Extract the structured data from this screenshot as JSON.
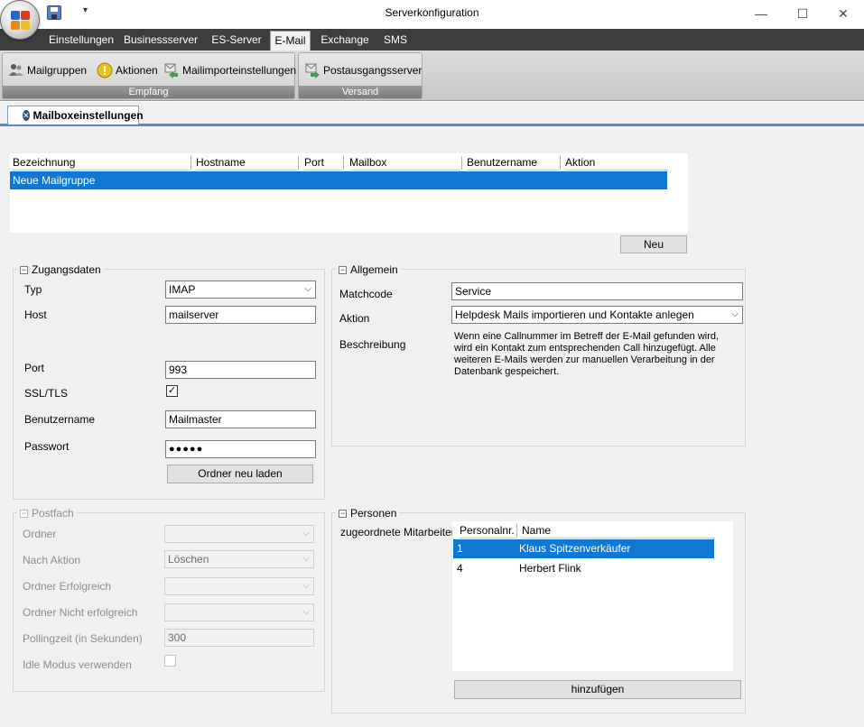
{
  "window": {
    "title": "Serverkonfiguration",
    "qat_dropdown": "▾",
    "minimize": "—",
    "maximize": "☐",
    "close": "✕"
  },
  "ribbon": {
    "tabs": [
      "Einstellungen",
      "Businessserver",
      "ES-Server",
      "E-Mail",
      "Exchange",
      "SMS"
    ],
    "active_tab": "E-Mail",
    "groups": [
      {
        "caption": "Empfang",
        "buttons": [
          {
            "label": "Mailgruppen",
            "icon": "people-icon"
          },
          {
            "label": "Aktionen",
            "icon": "warning-icon"
          },
          {
            "label": "Mailimporteinstellungen",
            "icon": "mail-import-icon"
          }
        ]
      },
      {
        "caption": "Versand",
        "buttons": [
          {
            "label": "Postausgangsserver",
            "icon": "mail-send-icon"
          }
        ]
      }
    ]
  },
  "document_tab": {
    "label": "Mailboxeinstellungen"
  },
  "mail_grid": {
    "columns": [
      "Bezeichnung",
      "Hostname",
      "Port",
      "Mailbox",
      "Benutzername",
      "Aktion"
    ],
    "rows": [
      {
        "Bezeichnung": "Neue Mailgruppe"
      }
    ],
    "new_button": "Neu"
  },
  "zugangsdaten": {
    "title": "Zugangsdaten",
    "typ_label": "Typ",
    "typ_value": "IMAP",
    "host_label": "Host",
    "host_value": "mailserver",
    "port_label": "Port",
    "port_value": "993",
    "ssl_label": "SSL/TLS",
    "ssl_checked": true,
    "check_mark": "✓",
    "user_label": "Benutzername",
    "user_value": "Mailmaster",
    "pass_label": "Passwort",
    "pass_value": "●●●●●",
    "reload_button": "Ordner neu laden"
  },
  "postfach": {
    "title": "Postfach",
    "ordner_label": "Ordner",
    "ordner_value": "",
    "nach_aktion_label": "Nach Aktion",
    "nach_aktion_value": "Löschen",
    "erfolgreich_label": "Ordner Erfolgreich",
    "erfolgreich_value": "",
    "nicht_erfolgreich_label": "Ordner Nicht erfolgreich",
    "nicht_erfolgreich_value": "",
    "polling_label": "Pollingzeit (in Sekunden)",
    "polling_value": "300",
    "idle_label": "Idle Modus verwenden"
  },
  "allgemein": {
    "title": "Allgemein",
    "matchcode_label": "Matchcode",
    "matchcode_value": "Service",
    "aktion_label": "Aktion",
    "aktion_value": "Helpdesk Mails importieren und Kontakte anlegen",
    "beschreibung_label": "Beschreibung",
    "beschreibung_text": "Wenn eine Callnummer im Betreff der E-Mail gefunden wird, wird ein Kontakt zum entsprechenden Call hinzugefügt. Alle weiteren E-Mails werden zur manuellen Verarbeitung in der Datenbank gespeichert."
  },
  "personen": {
    "title": "Personen",
    "label": "zugeordnete Mitarbeiter",
    "columns": [
      "Personalnr.",
      "Name"
    ],
    "rows": [
      {
        "nr": "1",
        "name": "Klaus Spitzenverkäufer"
      },
      {
        "nr": "4",
        "name": "Herbert Flink"
      }
    ],
    "add_button": "hinzufügen"
  },
  "collapse_glyph": "−",
  "dropdown_glyph": "⌵"
}
